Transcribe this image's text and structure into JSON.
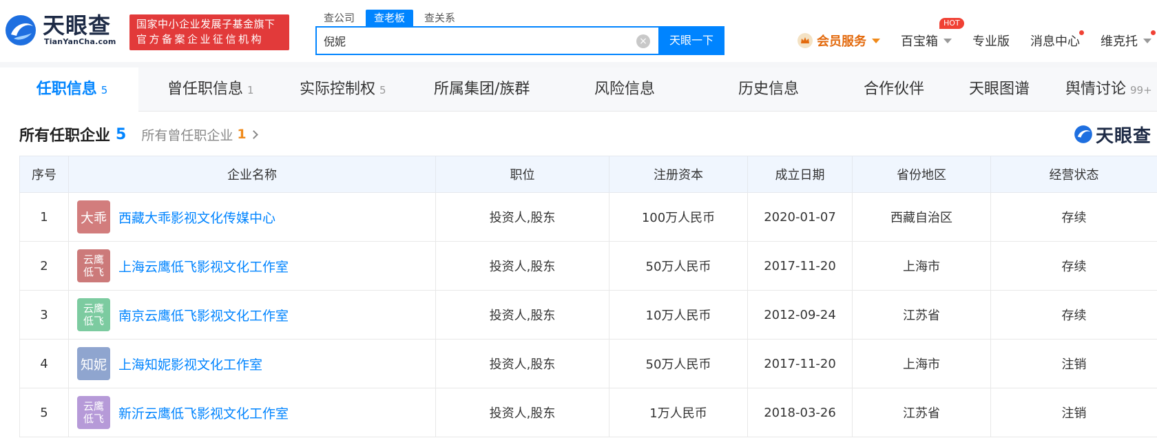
{
  "header": {
    "logo_cn": "天眼查",
    "logo_en": "TianYanCha.com",
    "gov_badge_line1": "国家中小企业发展子基金旗下",
    "gov_badge_line2": "官方备案企业征信机构",
    "search_tabs": [
      "查公司",
      "查老板",
      "查关系"
    ],
    "search_value": "倪妮",
    "search_button": "天眼一下",
    "nav": {
      "vip": "会员服务",
      "baibaoxiang": "百宝箱",
      "hot": "HOT",
      "pro": "专业版",
      "messages": "消息中心",
      "user": "维克托"
    }
  },
  "tabs": [
    {
      "label": "任职信息",
      "count": "5"
    },
    {
      "label": "曾任职信息",
      "count": "1"
    },
    {
      "label": "实际控制权",
      "count": "5"
    },
    {
      "label": "所属集团/族群",
      "count": ""
    },
    {
      "label": "风险信息",
      "count": ""
    },
    {
      "label": "历史信息",
      "count": ""
    },
    {
      "label": "合作伙伴",
      "count": ""
    },
    {
      "label": "天眼图谱",
      "count": ""
    },
    {
      "label": "舆情讨论",
      "count": "99+"
    }
  ],
  "section": {
    "title": "所有任职企业",
    "count": "5",
    "sub_label": "所有曾任职企业",
    "sub_count": "1",
    "watermark": "天眼查"
  },
  "table": {
    "headers": [
      "序号",
      "企业名称",
      "职位",
      "注册资本",
      "成立日期",
      "省份地区",
      "经营状态"
    ],
    "rows": [
      {
        "no": "1",
        "avatar": "大乖",
        "avatar_color": "#d27d7d",
        "name": "西藏大乖影视文化传媒中心",
        "role": "投资人,股东",
        "capital": "100万人民币",
        "date": "2020-01-07",
        "region": "西藏自治区",
        "status": "存续"
      },
      {
        "no": "2",
        "avatar": "云鹰低飞",
        "avatar_color": "#cc7a7a",
        "name": "上海云鹰低飞影视文化工作室",
        "role": "投资人,股东",
        "capital": "50万人民币",
        "date": "2017-11-20",
        "region": "上海市",
        "status": "存续"
      },
      {
        "no": "3",
        "avatar": "云鹰低飞",
        "avatar_color": "#7ccba0",
        "name": "南京云鹰低飞影视文化工作室",
        "role": "投资人,股东",
        "capital": "10万人民币",
        "date": "2012-09-24",
        "region": "江苏省",
        "status": "存续"
      },
      {
        "no": "4",
        "avatar": "知妮",
        "avatar_color": "#8fa5cf",
        "name": "上海知妮影视文化工作室",
        "role": "投资人,股东",
        "capital": "50万人民币",
        "date": "2017-11-20",
        "region": "上海市",
        "status": "注销"
      },
      {
        "no": "5",
        "avatar": "云鹰低飞",
        "avatar_color": "#b69ad8",
        "name": "新沂云鹰低飞影视文化工作室",
        "role": "投资人,股东",
        "capital": "1万人民币",
        "date": "2018-03-26",
        "region": "江苏省",
        "status": "注销"
      }
    ]
  },
  "colors": {
    "accent": "#0084ff",
    "status_active": "#13a84a",
    "status_cancelled": "#f04134",
    "badge_red": "#e23a3a"
  },
  "icons": [
    "tianyancha-logo-icon",
    "clear-icon",
    "crown-icon",
    "caret-down-icon",
    "chevron-right-icon"
  ]
}
